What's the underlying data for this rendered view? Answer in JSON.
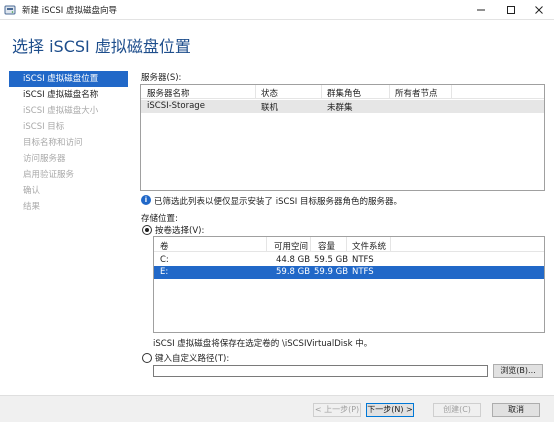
{
  "window": {
    "title": "新建 iSCSI 虚拟磁盘向导",
    "icon": "disk-wizard-icon"
  },
  "page_title": "选择 iSCSI 虚拟磁盘位置",
  "nav": {
    "items": [
      {
        "label": "iSCSI 虚拟磁盘位置",
        "state": "active"
      },
      {
        "label": "iSCSI 虚拟磁盘名称",
        "state": "normal"
      },
      {
        "label": "iSCSI 虚拟磁盘大小",
        "state": "disabled"
      },
      {
        "label": "iSCSI 目标",
        "state": "disabled"
      },
      {
        "label": "目标名称和访问",
        "state": "disabled"
      },
      {
        "label": "访问服务器",
        "state": "disabled"
      },
      {
        "label": "启用验证服务",
        "state": "disabled"
      },
      {
        "label": "确认",
        "state": "disabled"
      },
      {
        "label": "结果",
        "state": "disabled"
      }
    ]
  },
  "servers": {
    "label": "服务器(S):",
    "columns": [
      "服务器名称",
      "状态",
      "群集角色",
      "所有者节点"
    ],
    "rows": [
      {
        "name": "iSCSI-Storage",
        "status": "联机",
        "cluster_role": "未群集",
        "owner": ""
      }
    ]
  },
  "info_text": "已筛选此列表以便仅显示安装了 iSCSI 目标服务器角色的服务器。",
  "storage": {
    "label": "存储位置:",
    "by_volume_label": "按卷选择(V):",
    "by_volume_selected": true,
    "columns": [
      "卷",
      "可用空间",
      "容量",
      "文件系统"
    ],
    "volumes": [
      {
        "volume": "C:",
        "free": "44.8 GB",
        "capacity": "59.5 GB",
        "fs": "NTFS",
        "selected": false
      },
      {
        "volume": "E:",
        "free": "59.8 GB",
        "capacity": "59.9 GB",
        "fs": "NTFS",
        "selected": true
      }
    ],
    "save_note": "iSCSI 虚拟磁盘将保存在选定卷的 \\iSCSIVirtualDisk 中。",
    "custom_path_label": "键入自定义路径(T):",
    "custom_path_value": "",
    "browse_label": "浏览(B)..."
  },
  "footer": {
    "prev": "< 上一步(P)",
    "next": "下一步(N) >",
    "create": "创建(C)",
    "cancel": "取消"
  },
  "colors": {
    "accent": "#2168c8",
    "title": "#1e4e8c"
  }
}
